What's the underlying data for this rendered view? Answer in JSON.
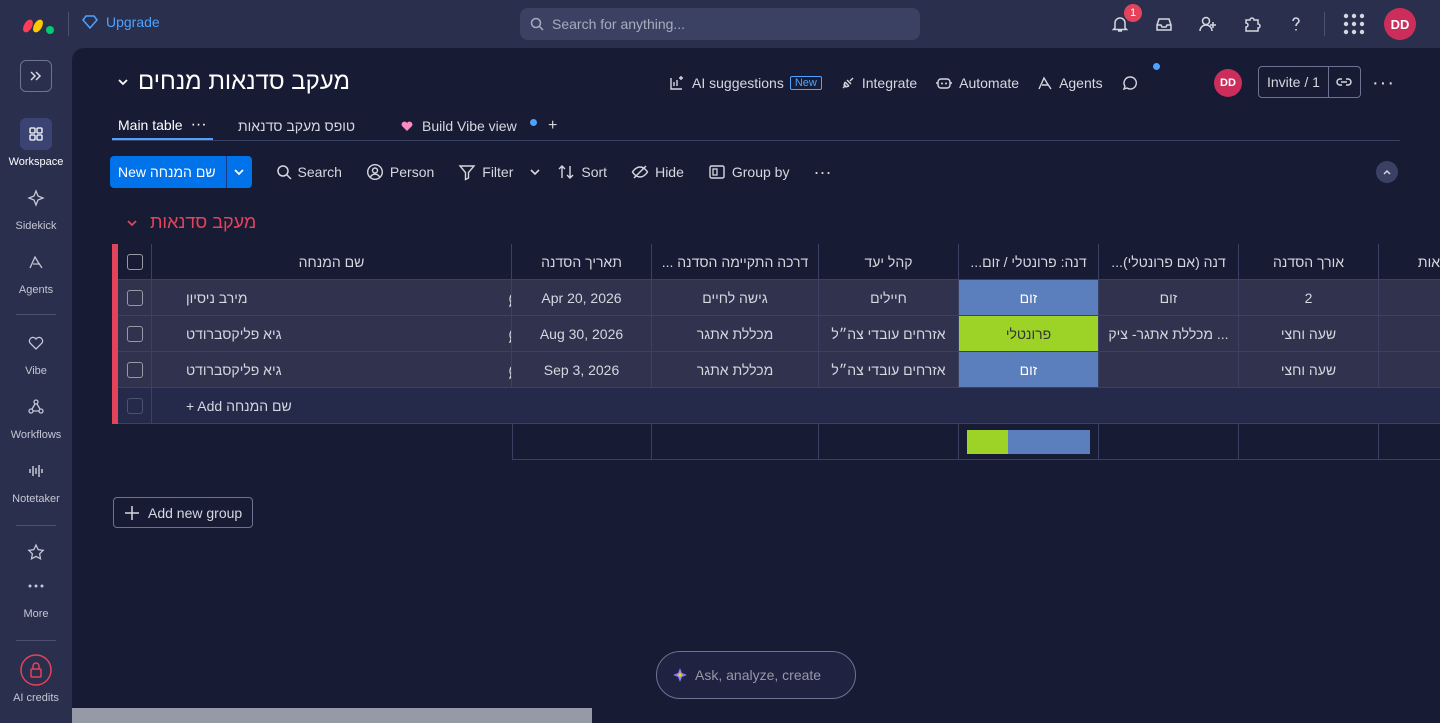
{
  "topbar": {
    "upgrade_label": "Upgrade",
    "search_placeholder": "Search for anything...",
    "notifications_count": "1",
    "user_initials": "DD"
  },
  "sidebar": {
    "items": [
      {
        "label": "Workspace",
        "icon": "grid-icon",
        "active": true
      },
      {
        "label": "Sidekick",
        "icon": "sparkle-icon"
      },
      {
        "label": "Agents",
        "icon": "agent-icon"
      },
      {
        "label": "Vibe",
        "icon": "heart-icon"
      },
      {
        "label": "Workflows",
        "icon": "workflow-icon"
      },
      {
        "label": "Notetaker",
        "icon": "waveform-icon"
      },
      {
        "label": "More",
        "icon": "more-icon"
      },
      {
        "label": "AI credits",
        "icon": "lock-icon"
      }
    ]
  },
  "board": {
    "title": "מעקב סדנאות מנחים",
    "actions": {
      "ai_suggestions": "AI suggestions",
      "new_badge": "New",
      "integrate": "Integrate",
      "automate": "Automate",
      "agents": "Agents"
    },
    "user_initials": "DD",
    "invite_label": "Invite / 1",
    "tabs": [
      {
        "label": "Main table"
      },
      {
        "label": "טופס מעקב סדנאות"
      },
      {
        "label": "Build Vibe view"
      }
    ]
  },
  "toolbar": {
    "new_item": "New שם המנחה",
    "search": "Search",
    "person": "Person",
    "filter": "Filter",
    "sort": "Sort",
    "hide": "Hide",
    "group_by": "Group by"
  },
  "group": {
    "title": "מעקב סדנאות",
    "columns": {
      "name": "שם המנחה",
      "date": "תאריך הסדנה",
      "method": "... דרכה התקיימה הסדנה",
      "audience": "קהל יעד",
      "format": "...דנה: פרונטלי / זום",
      "location": "...דנה (אם פרונטלי)",
      "length": "אורך הסדנה",
      "next": "אות"
    },
    "rows": [
      {
        "name": "מירב ניסיון",
        "date": "Apr 20, 2026",
        "method": "גישה לחיים",
        "audience": "חיילים",
        "format": "זום",
        "format_type": "zoom",
        "location": "זום",
        "length": "2"
      },
      {
        "name": "גיא פליקסברודט",
        "date": "Aug 30, 2026",
        "method": "מכללת אתגר",
        "audience": "אזרחים עובדי צה״ל",
        "format": "פרונטלי",
        "format_type": "inperson",
        "location": "מכללת אתגר- ציק ...",
        "length": "שעה וחצי"
      },
      {
        "name": "גיא פליקסברודט",
        "date": "Sep 3, 2026",
        "method": "מכללת אתגר",
        "audience": "אזרחים עובדי צה״ל",
        "format": "זום",
        "format_type": "zoom",
        "location": "",
        "length": "שעה וחצי"
      }
    ],
    "add_item": "+ Add שם המנחה",
    "format_summary": {
      "inperson_share": 0.33,
      "zoom_share": 0.67
    }
  },
  "colors": {
    "zoom": "#5b7fbd",
    "inperson": "#9cd326",
    "group": "#e2445c",
    "accent": "#0073ea"
  },
  "add_group_label": "Add new group",
  "ask_placeholder": "Ask, analyze, create"
}
